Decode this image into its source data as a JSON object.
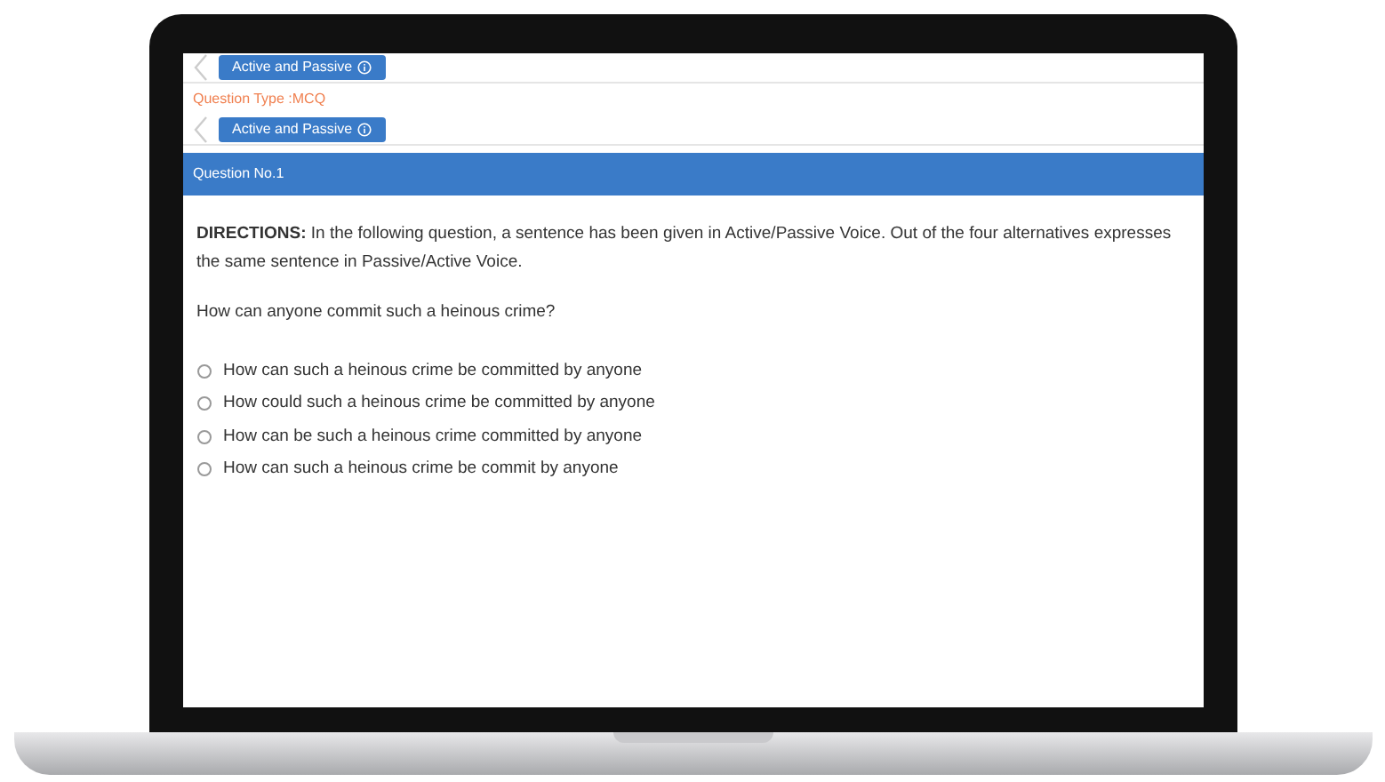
{
  "topic_buttons": [
    {
      "label": "Active and Passive"
    }
  ],
  "question_type": "Question Type :MCQ",
  "section_buttons": [
    {
      "label": "Active and Passive"
    }
  ],
  "question_header": "Question No.1",
  "directions": "**DIRECTIONS:** In the following question, a sentence has been given in Active/Passive Voice. Out of the four alternatives expresses the same sentence in Passive/Active Voice.",
  "question": "How can anyone commit such a heinous crime?",
  "options": [
    {
      "label": "How can such a heinous crime be committed by anyone",
      "selected": false
    },
    {
      "label": "How could such a heinous crime be committed by anyone",
      "selected": false
    },
    {
      "label": "How can be such a heinous crime committed by anyone",
      "selected": false
    },
    {
      "label": "How can such a heinous crime be commit by anyone",
      "selected": false
    }
  ]
}
